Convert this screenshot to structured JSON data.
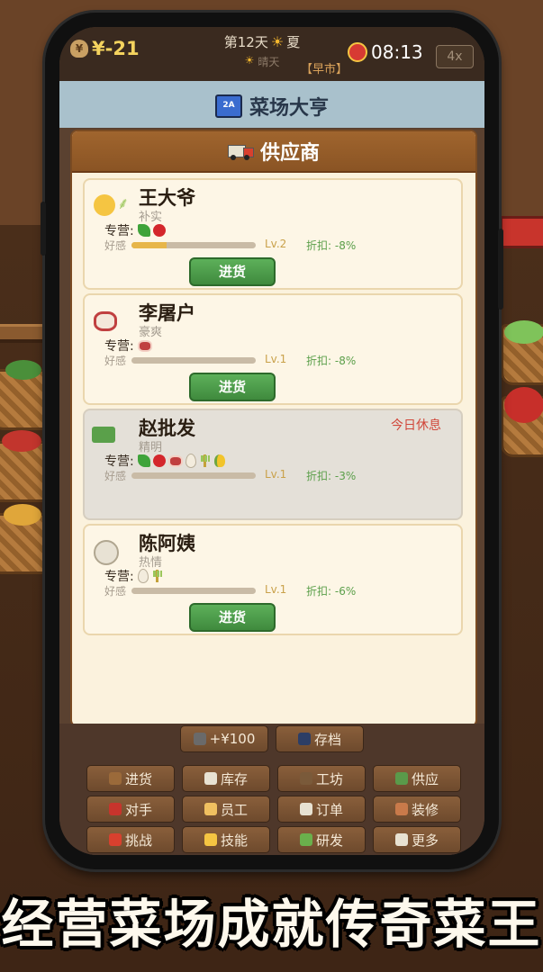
{
  "status": {
    "money": "¥-21",
    "day": "第12天",
    "season": "夏",
    "weather": "晴天",
    "market": "【早市】",
    "time": "08:13",
    "speed": "4x"
  },
  "title": "菜场大亨",
  "title_badge": "2A",
  "panel": {
    "title": "供应商",
    "spec_label": "专营:",
    "favor_label": "好感",
    "buy_label": "进货",
    "suppliers": [
      {
        "name": "王大爷",
        "trait": "补实",
        "items": [
          "vegetable",
          "apple"
        ],
        "favor": 0.28,
        "level": "Lv.2",
        "discount": "折扣: -8%",
        "resting": false
      },
      {
        "name": "李屠户",
        "trait": "豪爽",
        "items": [
          "meat"
        ],
        "favor": 0.0,
        "level": "Lv.1",
        "discount": "折扣: -8%",
        "resting": false
      },
      {
        "name": "赵批发",
        "trait": "精明",
        "items": [
          "vegetable",
          "apple",
          "meat",
          "egg",
          "wheat",
          "corn"
        ],
        "favor": 0.0,
        "level": "Lv.1",
        "discount": "折扣: -3%",
        "resting": true,
        "rest_label": "今日休息"
      },
      {
        "name": "陈阿姨",
        "trait": "热情",
        "items": [
          "egg",
          "wheat"
        ],
        "favor": 0.0,
        "level": "Lv.1",
        "discount": "折扣: -6%",
        "resting": false
      }
    ]
  },
  "menu": {
    "ad_reward": "+¥100",
    "save": "存档",
    "buttons": [
      {
        "label": "进货",
        "icon": "box-icon",
        "color": "#9b6a3a"
      },
      {
        "label": "库存",
        "icon": "clipboard-icon",
        "color": "#e8e2d2"
      },
      {
        "label": "工坊",
        "icon": "hammer-icon",
        "color": "#7a5a3a"
      },
      {
        "label": "供应",
        "icon": "truck-icon",
        "color": "#5a9a4a"
      },
      {
        "label": "对手",
        "icon": "shop-icon",
        "color": "#c8342c"
      },
      {
        "label": "员工",
        "icon": "worker-icon",
        "color": "#f0c060"
      },
      {
        "label": "订单",
        "icon": "order-icon",
        "color": "#e8e2d2"
      },
      {
        "label": "装修",
        "icon": "palette-icon",
        "color": "#c97a4a"
      },
      {
        "label": "挑战",
        "icon": "target-icon",
        "color": "#d8402e"
      },
      {
        "label": "技能",
        "icon": "star-icon",
        "color": "#f5c542"
      },
      {
        "label": "研发",
        "icon": "cucumber-icon",
        "color": "#6ab04c"
      },
      {
        "label": "更多",
        "icon": "book-icon",
        "color": "#e8e2d2"
      }
    ]
  },
  "slogan": "经营菜场成就传奇菜王"
}
